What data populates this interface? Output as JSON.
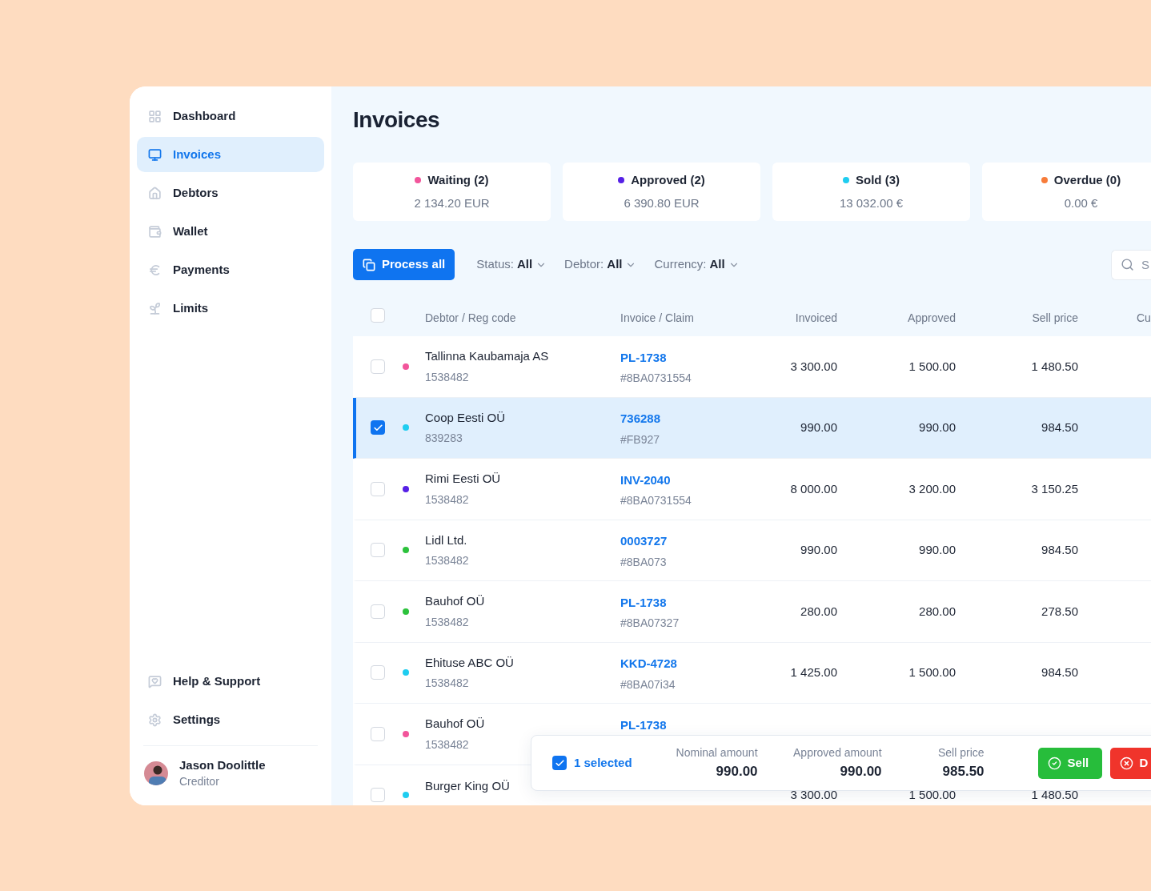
{
  "sidebar": {
    "items": [
      {
        "label": "Dashboard",
        "selected": false
      },
      {
        "label": "Invoices",
        "selected": true
      },
      {
        "label": "Debtors",
        "selected": false
      },
      {
        "label": "Wallet",
        "selected": false
      },
      {
        "label": "Payments",
        "selected": false
      },
      {
        "label": "Limits",
        "selected": false
      }
    ],
    "bottom_items": [
      {
        "label": "Help & Support"
      },
      {
        "label": "Settings"
      }
    ],
    "user": {
      "name": "Jason Doolittle",
      "role": "Creditor"
    }
  },
  "page_title": "Invoices",
  "stats": [
    {
      "label": "Waiting (2)",
      "value": "2 134.20 EUR",
      "color": "#f2559b"
    },
    {
      "label": "Approved (2)",
      "value": "6 390.80 EUR",
      "color": "#5620e6"
    },
    {
      "label": "Sold (3)",
      "value": "13 032.00 €",
      "color": "#1fcdf0"
    },
    {
      "label": "Overdue (0)",
      "value": "0.00 €",
      "color": "#f77c3a"
    }
  ],
  "toolbar": {
    "process_button": "Process all",
    "filters": [
      {
        "label": "Status:",
        "value": "All"
      },
      {
        "label": "Debtor:",
        "value": "All"
      },
      {
        "label": "Currency:",
        "value": "All"
      }
    ],
    "search": {
      "placeholder": "S"
    }
  },
  "table": {
    "header_checked": false,
    "columns": [
      "Debtor / Reg code",
      "Invoice / Claim",
      "Invoiced",
      "Approved",
      "Sell price",
      "Cu"
    ],
    "rows": [
      {
        "debtor": "Tallinna Kaubamaja AS",
        "reg_code": "1538482",
        "invoice": "PL-1738",
        "claim": "#8BA0731554",
        "invoiced": "3 300.00",
        "approved": "1 500.00",
        "sell_price": "1 480.50",
        "color": "#f2559b",
        "selected": false
      },
      {
        "debtor": "Coop Eesti OÜ",
        "reg_code": "839283",
        "invoice": "736288",
        "claim": "#FB927",
        "invoiced": "990.00",
        "approved": "990.00",
        "sell_price": "984.50",
        "color": "#1fcdf0",
        "selected": true
      },
      {
        "debtor": "Rimi Eesti OÜ",
        "reg_code": "1538482",
        "invoice": "INV-2040",
        "claim": "#8BA0731554",
        "invoiced": "8 000.00",
        "approved": "3 200.00",
        "sell_price": "3 150.25",
        "color": "#5620e6",
        "selected": false
      },
      {
        "debtor": "Lidl Ltd.",
        "reg_code": "1538482",
        "invoice": "0003727",
        "claim": "#8BA073",
        "invoiced": "990.00",
        "approved": "990.00",
        "sell_price": "984.50",
        "color": "#2cc23c",
        "selected": false
      },
      {
        "debtor": "Bauhof OÜ",
        "reg_code": "1538482",
        "invoice": "PL-1738",
        "claim": "#8BA07327",
        "invoiced": "280.00",
        "approved": "280.00",
        "sell_price": "278.50",
        "color": "#2cc23c",
        "selected": false
      },
      {
        "debtor": "Ehituse ABC OÜ",
        "reg_code": "1538482",
        "invoice": "KKD-4728",
        "claim": "#8BA07i34",
        "invoiced": "1 425.00",
        "approved": "1 500.00",
        "sell_price": "984.50",
        "color": "#1fcdf0",
        "selected": false
      },
      {
        "debtor": "Bauhof OÜ",
        "reg_code": "1538482",
        "invoice": "PL-1738",
        "color": "#f2559b",
        "selected": false
      },
      {
        "debtor": "Burger King OÜ",
        "invoiced": "3 300.00",
        "approved": "1 500.00",
        "sell_price": "1 480.50",
        "color": "#1fcdf0",
        "selected": false
      }
    ]
  },
  "selection_bar": {
    "checked": true,
    "count": "1 selected",
    "totals": [
      {
        "label": "Nominal amount",
        "value": "990.00"
      },
      {
        "label": "Approved amount",
        "value": "990.00"
      },
      {
        "label": "Sell price",
        "value": "985.50"
      }
    ],
    "buttons": [
      {
        "label": "Sell",
        "kind": "sell"
      },
      {
        "label": "D",
        "kind": "decline"
      }
    ]
  }
}
